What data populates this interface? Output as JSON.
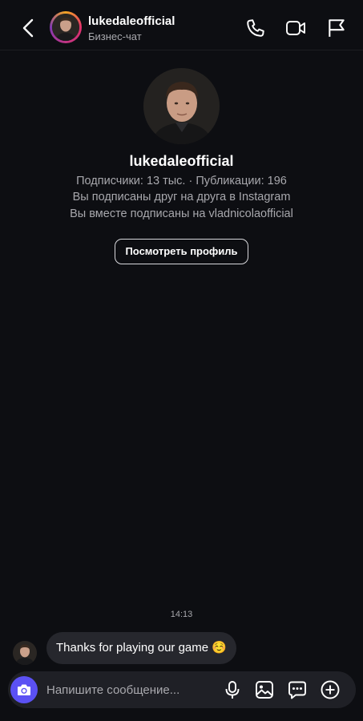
{
  "header": {
    "username": "lukedaleofficial",
    "subtitle": "Бизнес-чат",
    "icons": [
      "back-arrow-icon",
      "phone-icon",
      "video-camera-icon",
      "flag-icon"
    ]
  },
  "profile": {
    "username": "lukedaleofficial",
    "stats": "Подписчики: 13 тыс. · Публикации: 196",
    "mutual_follow": "Вы подписаны друг на друга в Instagram",
    "common_follow": "Вы вместе подписаны на vladnicolaofficial",
    "view_profile_label": "Посмотреть профиль"
  },
  "conversation": {
    "timestamp": "14:13",
    "messages": [
      {
        "text": "Thanks for playing our game ☺️",
        "from": "lukedaleofficial"
      }
    ]
  },
  "composer": {
    "placeholder": "Напишите сообщение...",
    "icons": [
      "camera-icon",
      "microphone-icon",
      "gallery-icon",
      "sticker-icon",
      "plus-icon"
    ]
  },
  "colors": {
    "background": "#0d0e12",
    "accent_camera": "#5b51f4",
    "bubble": "#26272d",
    "secondary_text": "#a8a8ad"
  }
}
